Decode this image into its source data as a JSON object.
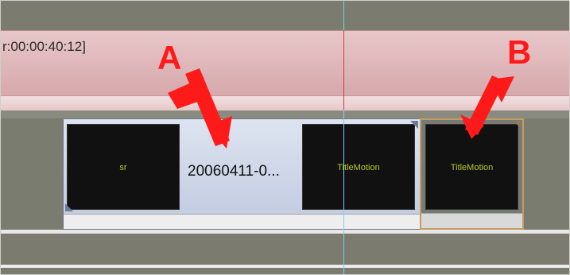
{
  "timeline": {
    "title_track_label": "r:00:00:40:12]"
  },
  "clips": {
    "clip_a": {
      "name": "20060411-0...",
      "thumb_left_text": "sr",
      "thumb_right_text": "TitleMotion"
    },
    "clip_b": {
      "thumb_text": "TitleMotion"
    }
  },
  "annotations": {
    "a": "A",
    "b": "B"
  },
  "colors": {
    "annotation": "#ff1a1a",
    "playhead": "#76d3e6",
    "selected_border": "#c59b62"
  }
}
